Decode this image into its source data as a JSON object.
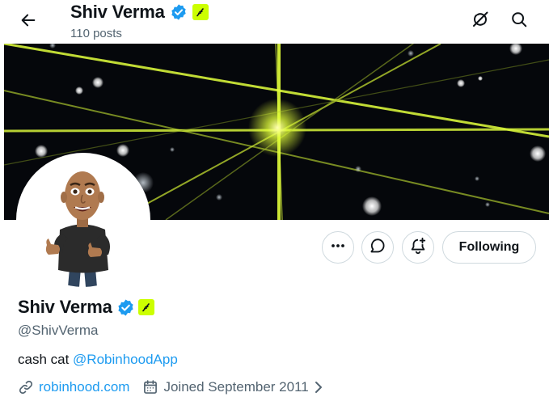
{
  "header": {
    "name": "Shiv Verma",
    "posts": "110 posts"
  },
  "profile": {
    "name": "Shiv Verma",
    "handle": "@ShivVerma",
    "bio_text": "cash cat ",
    "bio_link": "@RobinhoodApp",
    "website": "robinhood.com",
    "joined": "Joined September 2011"
  },
  "actions": {
    "follow_label": "Following"
  },
  "icons": {
    "back": "back-arrow-icon",
    "grok": "grok-icon",
    "search": "search-icon",
    "more": "more-icon",
    "message": "message-icon",
    "notify": "bell-plus-icon",
    "verified": "verified-badge-icon",
    "affiliate": "feather-badge-icon",
    "link": "link-icon",
    "calendar": "calendar-icon",
    "chevron": "chevron-right-icon"
  },
  "colors": {
    "verified": "#1d9bf0",
    "link": "#1d9bf0",
    "affiliate_badge": "#ccff00",
    "banner_bg": "#05070b",
    "banner_lines": "#d6f23a"
  }
}
